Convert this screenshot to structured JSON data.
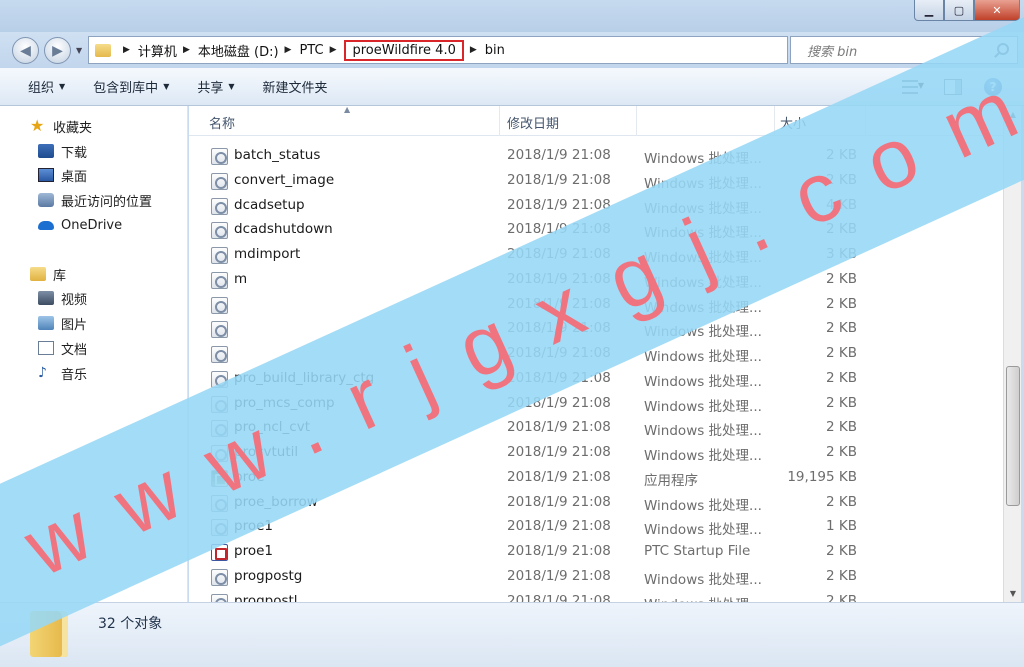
{
  "addressbar": {
    "crumbs": [
      "计算机",
      "本地磁盘 (D:)",
      "PTC",
      "proeWildfire 4.0",
      "bin"
    ]
  },
  "search": {
    "placeholder": "搜索 bin"
  },
  "toolbar": {
    "organize": "组织",
    "include_library": "包含到库中",
    "share": "共享",
    "new_folder": "新建文件夹"
  },
  "sidebar": {
    "favorites": "收藏夹",
    "downloads": "下载",
    "desktop": "桌面",
    "recent": "最近访问的位置",
    "onedrive": "OneDrive",
    "libraries": "库",
    "videos": "视频",
    "pictures": "图片",
    "documents": "文档",
    "music": "音乐"
  },
  "columns": {
    "name": "名称",
    "modified": "修改日期",
    "size": "大小"
  },
  "files": [
    {
      "name": "batch_status",
      "date": "2018/1/9 21:08",
      "type": "Windows 批处理...",
      "size": "2 KB",
      "icon": "batch"
    },
    {
      "name": "convert_image",
      "date": "2018/1/9 21:08",
      "type": "Windows 批处理...",
      "size": "2 KB",
      "icon": "batch"
    },
    {
      "name": "dcadsetup",
      "date": "2018/1/9 21:08",
      "type": "Windows 批处理...",
      "size": "4 KB",
      "icon": "batch"
    },
    {
      "name": "dcadshutdown",
      "date": "2018/1/9 21:08",
      "type": "Windows 批处理...",
      "size": "2 KB",
      "icon": "batch"
    },
    {
      "name": "mdimport",
      "date": "2018/1/9 21:08",
      "type": "Windows 批处理...",
      "size": "3 KB",
      "icon": "batch"
    },
    {
      "name": "m",
      "date": "2018/1/9 21:08",
      "type": "Windows 批处理...",
      "size": "2 KB",
      "icon": "batch"
    },
    {
      "name": "",
      "date": "2018/1/9 21:08",
      "type": "Windows 批处理...",
      "size": "2 KB",
      "icon": "batch"
    },
    {
      "name": "",
      "date": "2018/1/9 21:08",
      "type": "Windows 批处理...",
      "size": "2 KB",
      "icon": "batch"
    },
    {
      "name": "",
      "date": "2018/1/9 21:08",
      "type": "Windows 批处理...",
      "size": "2 KB",
      "icon": "batch"
    },
    {
      "name": "pro_build_library_ctg",
      "date": "2018/1/9 21:08",
      "type": "Windows 批处理...",
      "size": "2 KB",
      "icon": "batch"
    },
    {
      "name": "pro_mcs_comp",
      "date": "2018/1/9 21:08",
      "type": "Windows 批处理...",
      "size": "2 KB",
      "icon": "batch"
    },
    {
      "name": "pro_ncl_cvt",
      "date": "2018/1/9 21:08",
      "type": "Windows 批处理...",
      "size": "2 KB",
      "icon": "batch"
    },
    {
      "name": "procvtutil",
      "date": "2018/1/9 21:08",
      "type": "Windows 批处理...",
      "size": "2 KB",
      "icon": "batch"
    },
    {
      "name": "proe",
      "date": "2018/1/9 21:08",
      "type": "应用程序",
      "size": "19,195 KB",
      "icon": "exe"
    },
    {
      "name": "proe_borrow",
      "date": "2018/1/9 21:08",
      "type": "Windows 批处理...",
      "size": "2 KB",
      "icon": "batch"
    },
    {
      "name": "proe1",
      "date": "2018/1/9 21:08",
      "type": "Windows 批处理...",
      "size": "1 KB",
      "icon": "batch"
    },
    {
      "name": "proe1",
      "date": "2018/1/9 21:08",
      "type": "PTC Startup File",
      "size": "2 KB",
      "icon": "ptc"
    },
    {
      "name": "progpostg",
      "date": "2018/1/9 21:08",
      "type": "Windows 批处理...",
      "size": "2 KB",
      "icon": "batch"
    },
    {
      "name": "progpostl",
      "date": "2018/1/9 21:08",
      "type": "Windows 批处理...",
      "size": "2 KB",
      "icon": "batch"
    }
  ],
  "status": {
    "count": "32 个对象"
  },
  "watermark": {
    "text": "www.rjgxgj.com"
  }
}
